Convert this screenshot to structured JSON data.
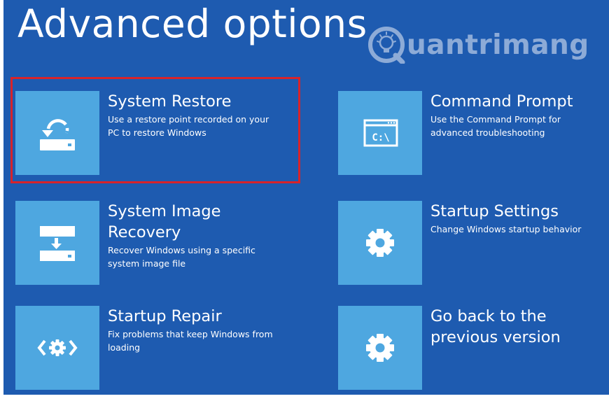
{
  "page": {
    "title": "Advanced options"
  },
  "watermark": {
    "text": "uantrimang",
    "icon": "lightbulb-q-icon"
  },
  "options": [
    {
      "title": "System Restore",
      "description": [
        "Use a restore point recorded on your",
        "PC to restore Windows"
      ],
      "icon": "system-restore-icon",
      "selected": true
    },
    {
      "title": "Command Prompt",
      "description": [
        "Use the Command Prompt for",
        "advanced troubleshooting"
      ],
      "icon": "command-prompt-icon",
      "icon_text": "C:\\"
    },
    {
      "title": [
        "System Image",
        "Recovery"
      ],
      "description": [
        "Recover Windows using a specific",
        "system image file"
      ],
      "icon": "system-image-recovery-icon"
    },
    {
      "title": "Startup Settings",
      "description": [
        "Change Windows startup behavior"
      ],
      "icon": "gear-icon"
    },
    {
      "title": "Startup Repair",
      "description": [
        "Fix problems that keep Windows from",
        "loading"
      ],
      "icon": "startup-repair-icon"
    },
    {
      "title": [
        "Go back to the",
        "previous version"
      ],
      "description": [],
      "icon": "gear-icon"
    }
  ],
  "colors": {
    "background": "#1e5bb0",
    "tile": "#4ea7e0",
    "text": "#ffffff",
    "highlight_border": "#d8232a"
  }
}
